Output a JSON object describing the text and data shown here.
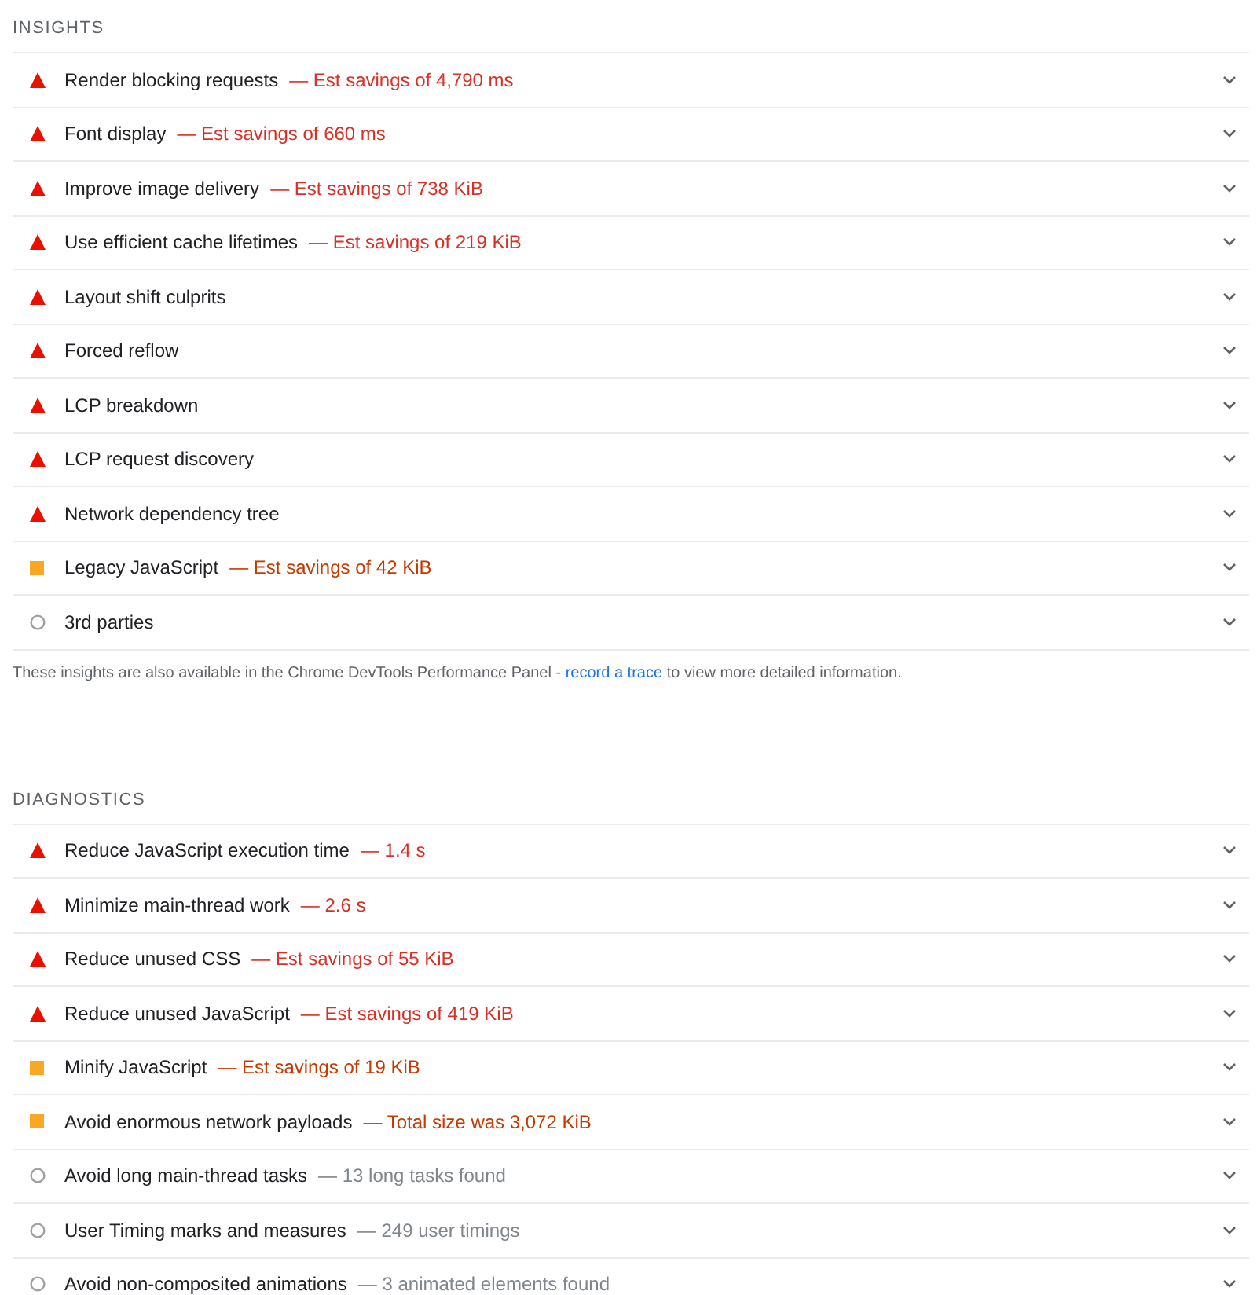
{
  "sections": [
    {
      "heading": "INSIGHTS",
      "items": [
        {
          "kind": "fail",
          "title": "Render blocking requests",
          "detail": "— Est savings of 4,790 ms"
        },
        {
          "kind": "fail",
          "title": "Font display",
          "detail": "— Est savings of 660 ms"
        },
        {
          "kind": "fail",
          "title": "Improve image delivery",
          "detail": "— Est savings of 738 KiB"
        },
        {
          "kind": "fail",
          "title": "Use efficient cache lifetimes",
          "detail": "— Est savings of 219 KiB"
        },
        {
          "kind": "fail",
          "title": "Layout shift culprits"
        },
        {
          "kind": "fail",
          "title": "Forced reflow"
        },
        {
          "kind": "fail",
          "title": "LCP breakdown"
        },
        {
          "kind": "fail",
          "title": "LCP request discovery"
        },
        {
          "kind": "fail",
          "title": "Network dependency tree"
        },
        {
          "kind": "average",
          "title": "Legacy JavaScript",
          "detail": "— Est savings of 42 KiB"
        },
        {
          "kind": "info",
          "title": "3rd parties"
        }
      ],
      "note": {
        "before": "These insights are also available in the Chrome DevTools Performance Panel - ",
        "link": "record a trace",
        "after": " to view more detailed information."
      }
    },
    {
      "heading": "DIAGNOSTICS",
      "items": [
        {
          "kind": "fail",
          "title": "Reduce JavaScript execution time",
          "detail": "— 1.4 s"
        },
        {
          "kind": "fail",
          "title": "Minimize main-thread work",
          "detail": "— 2.6 s"
        },
        {
          "kind": "fail",
          "title": "Reduce unused CSS",
          "detail": "— Est savings of 55 KiB"
        },
        {
          "kind": "fail",
          "title": "Reduce unused JavaScript",
          "detail": "— Est savings of 419 KiB"
        },
        {
          "kind": "average",
          "title": "Minify JavaScript",
          "detail": "— Est savings of 19 KiB"
        },
        {
          "kind": "average",
          "title": "Avoid enormous network payloads",
          "detail": "— Total size was 3,072 KiB"
        },
        {
          "kind": "info",
          "title": "Avoid long main-thread tasks",
          "detail": "— 13 long tasks found"
        },
        {
          "kind": "info",
          "title": "User Timing marks and measures",
          "detail": "— 249 user timings"
        },
        {
          "kind": "info",
          "title": "Avoid non-composited animations",
          "detail": "— 3 animated elements found"
        }
      ]
    }
  ]
}
